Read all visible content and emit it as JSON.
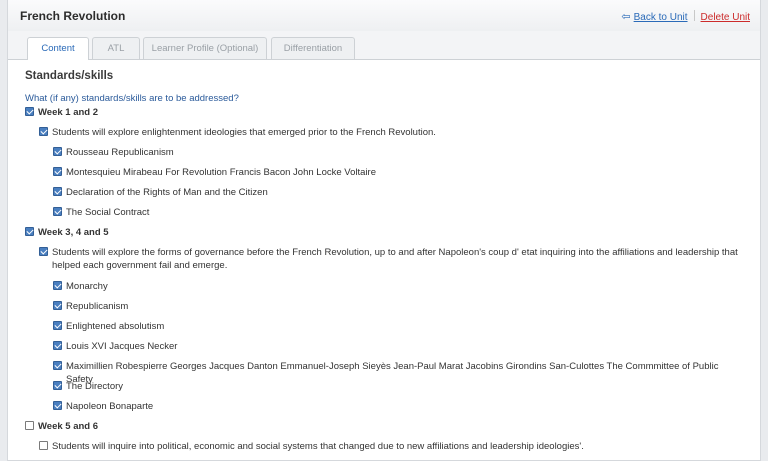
{
  "header": {
    "title": "French Revolution",
    "back_label": "Back to Unit",
    "delete_label": "Delete Unit"
  },
  "tabs": [
    {
      "label": "Content",
      "active": true
    },
    {
      "label": "ATL",
      "active": false
    },
    {
      "label": "Learner Profile (Optional)",
      "active": false
    },
    {
      "label": "Differentiation",
      "active": false
    }
  ],
  "section": {
    "title": "Standards/skills",
    "question": "What (if any) standards/skills are to be addressed?"
  },
  "items": [
    {
      "label": "Week 1 and 2",
      "checked": true
    },
    {
      "label": "Students will explore enlightenment ideologies that emerged prior to the French Revolution.",
      "checked": true
    },
    {
      "label": "Rousseau Republicanism",
      "checked": true
    },
    {
      "label": "Montesquieu Mirabeau For Revolution Francis Bacon John Locke Voltaire",
      "checked": true
    },
    {
      "label": "Declaration of the Rights of Man and the Citizen",
      "checked": true
    },
    {
      "label": "The Social Contract",
      "checked": true
    },
    {
      "label": "Week 3, 4 and 5",
      "checked": true
    },
    {
      "label": "Students will explore the forms of governance before the French Revolution, up to and after Napoleon's coup d' etat inquiring into the affiliations and leadership that helped each government fail and emerge.",
      "checked": true
    },
    {
      "label": "Monarchy",
      "checked": true
    },
    {
      "label": "Republicanism",
      "checked": true
    },
    {
      "label": "Enlightened absolutism",
      "checked": true
    },
    {
      "label": "Louis XVI Jacques Necker",
      "checked": true
    },
    {
      "label": "Maximillien Robespierre Georges Jacques Danton Emmanuel-Joseph Sieyès Jean-Paul Marat Jacobins Girondins San-Culottes The Commmittee of Public Safety",
      "checked": true
    },
    {
      "label": "The Directory",
      "checked": true
    },
    {
      "label": "Napoleon Bonaparte",
      "checked": true
    },
    {
      "label": "Week 5 and 6",
      "checked": false
    },
    {
      "label": "Students will inquire into political, economic and social systems that changed due to new affiliations and leadership ideologies'.",
      "checked": false
    }
  ]
}
